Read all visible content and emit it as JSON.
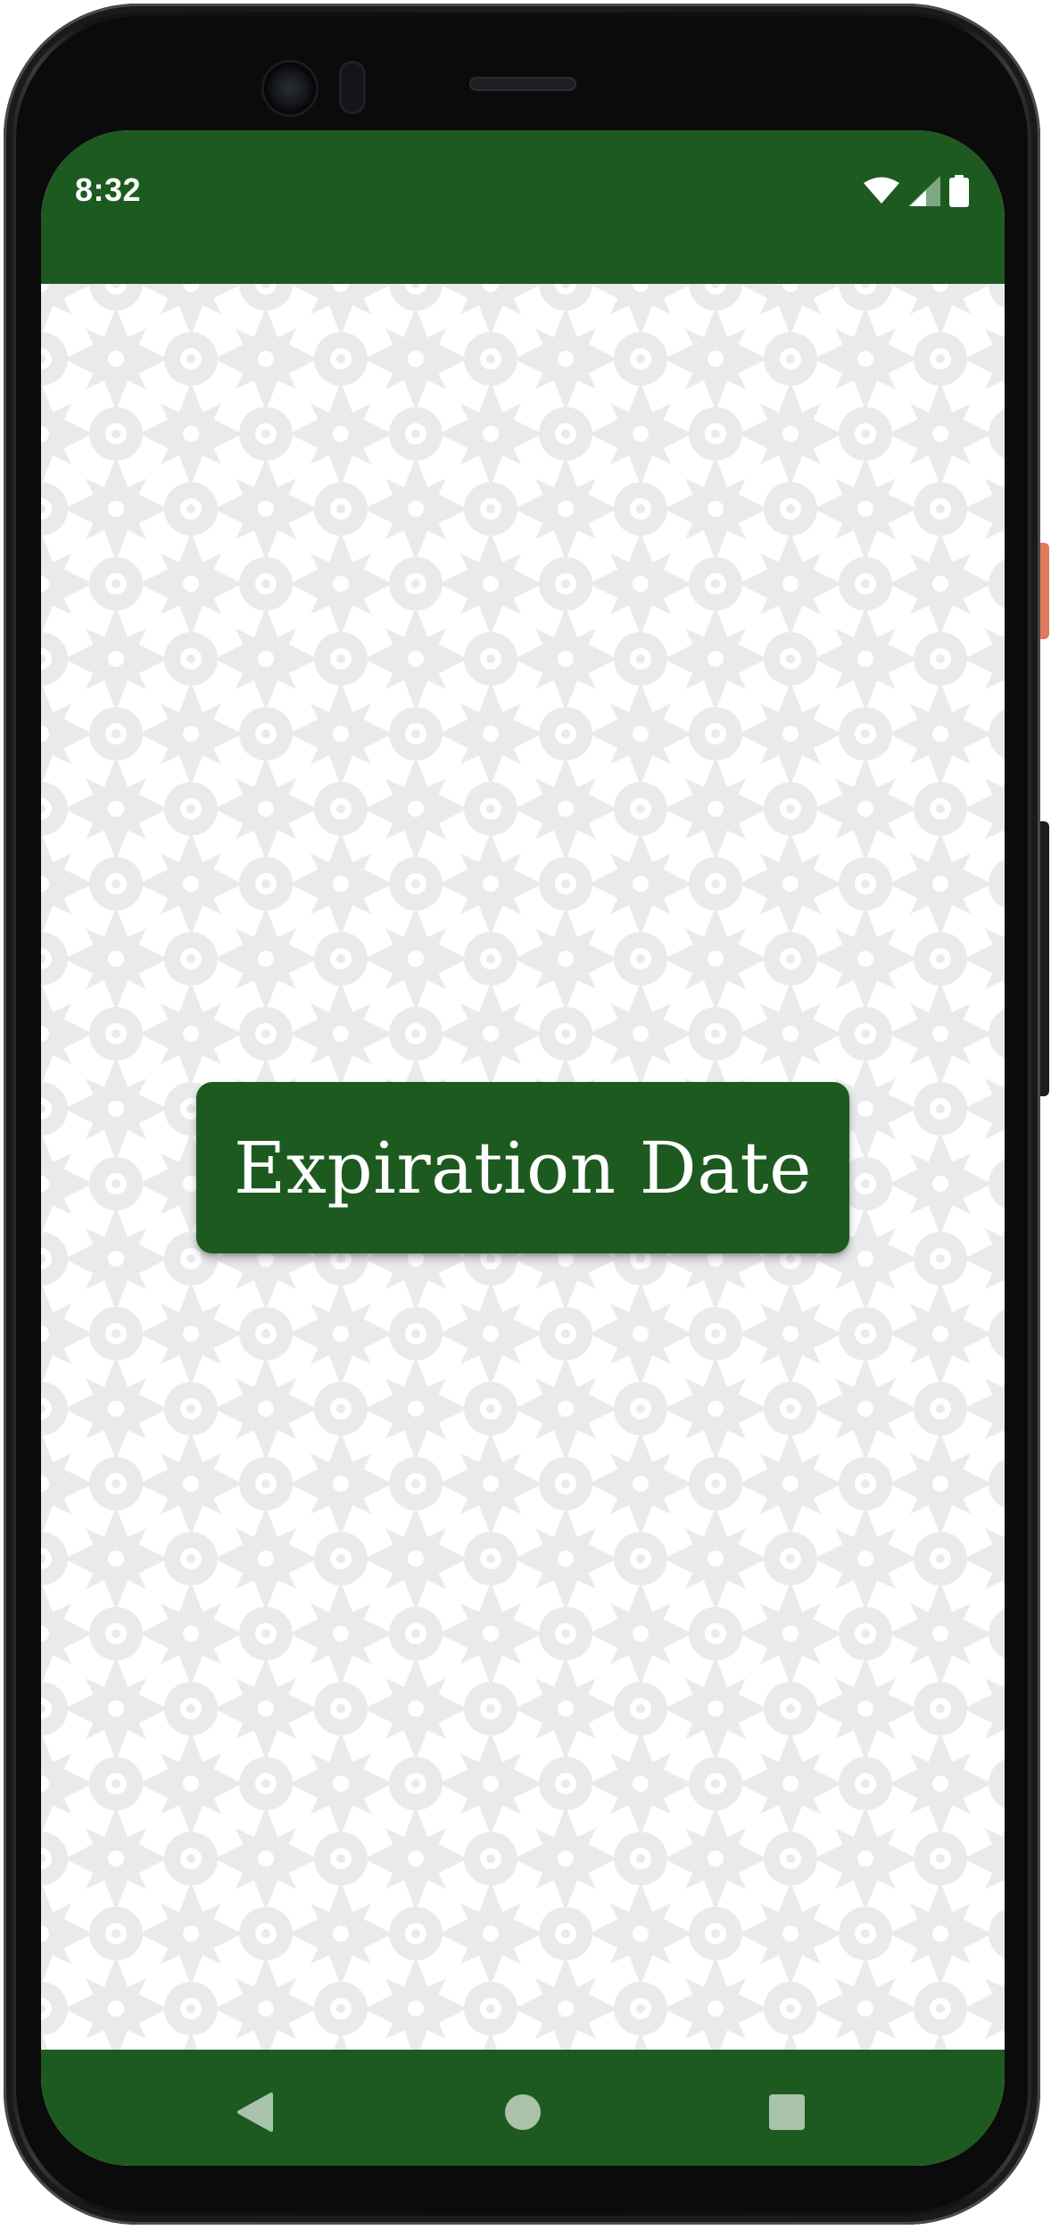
{
  "status_bar": {
    "time": "8:32",
    "icons": [
      "wifi-icon",
      "cell-signal-icon",
      "battery-icon"
    ]
  },
  "main": {
    "label": "Expiration Date"
  },
  "nav_bar": {
    "buttons": [
      "back-icon",
      "home-icon",
      "recents-icon"
    ]
  },
  "colors": {
    "primary": "#1d5a20",
    "on_primary": "#ffffff",
    "pattern": "#e9eaec",
    "nav_icon": "#a8c3a9"
  }
}
